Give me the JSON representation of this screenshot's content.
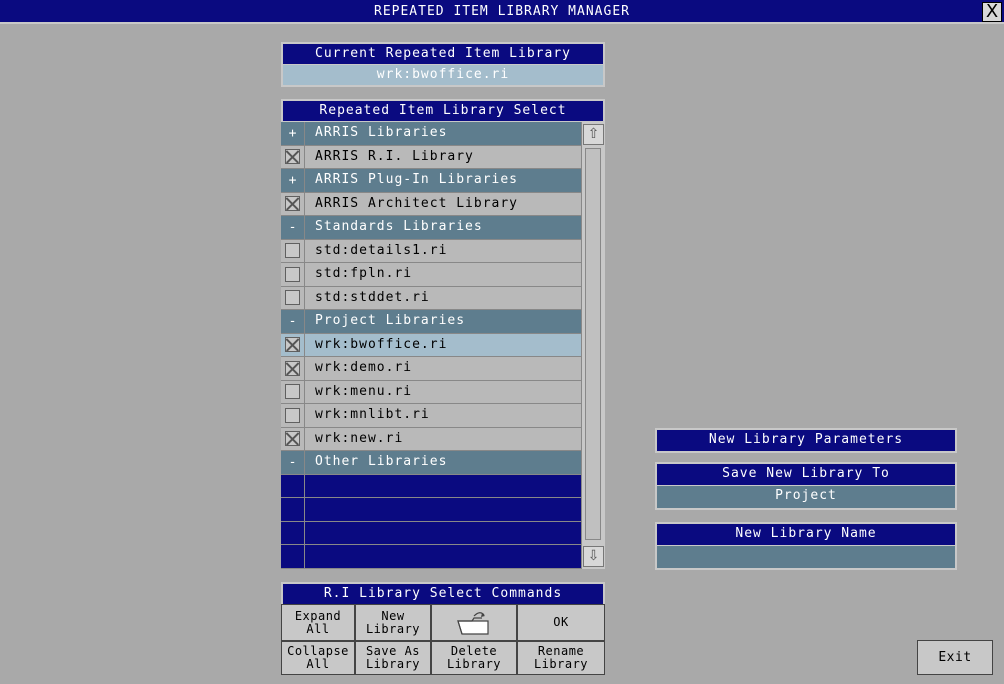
{
  "window": {
    "title": "REPEATED ITEM LIBRARY MANAGER",
    "close_label": "X"
  },
  "current": {
    "header": "Current Repeated Item Library",
    "value": "wrk:bwoffice.ri"
  },
  "select": {
    "header": "Repeated Item Library Select",
    "rows": [
      {
        "type": "group",
        "toggle": "+",
        "label": "ARRIS Libraries"
      },
      {
        "type": "item",
        "checked": true,
        "label": "ARRIS R.I. Library"
      },
      {
        "type": "group",
        "toggle": "+",
        "label": "ARRIS Plug-In Libraries"
      },
      {
        "type": "item",
        "checked": true,
        "label": "ARRIS Architect Library"
      },
      {
        "type": "group",
        "toggle": "-",
        "label": "Standards Libraries"
      },
      {
        "type": "item",
        "checked": false,
        "label": "std:details1.ri"
      },
      {
        "type": "item",
        "checked": false,
        "label": "std:fpln.ri"
      },
      {
        "type": "item",
        "checked": false,
        "label": "std:stddet.ri"
      },
      {
        "type": "group",
        "toggle": "-",
        "label": "Project Libraries"
      },
      {
        "type": "item",
        "checked": true,
        "selected": true,
        "label": "wrk:bwoffice.ri"
      },
      {
        "type": "item",
        "checked": true,
        "label": "wrk:demo.ri"
      },
      {
        "type": "item",
        "checked": false,
        "label": "wrk:menu.ri"
      },
      {
        "type": "item",
        "checked": false,
        "label": "wrk:mnlibt.ri"
      },
      {
        "type": "item",
        "checked": true,
        "label": "wrk:new.ri"
      },
      {
        "type": "group",
        "toggle": "-",
        "label": "Other Libraries"
      },
      {
        "type": "empty"
      },
      {
        "type": "empty"
      },
      {
        "type": "empty"
      },
      {
        "type": "empty"
      }
    ]
  },
  "commands": {
    "header": "R.I Library Select Commands",
    "expand_all": "Expand\nAll",
    "new_library": "New\nLibrary",
    "ok": "OK",
    "collapse_all": "Collapse\nAll",
    "save_as_library": "Save As\nLibrary",
    "delete_library": "Delete\nLibrary",
    "rename_library": "Rename\nLibrary"
  },
  "params": {
    "header": "New Library Parameters",
    "save_to_header": "Save New Library To",
    "save_to_value": "Project",
    "name_header": "New Library Name",
    "name_value": ""
  },
  "exit_label": "Exit"
}
